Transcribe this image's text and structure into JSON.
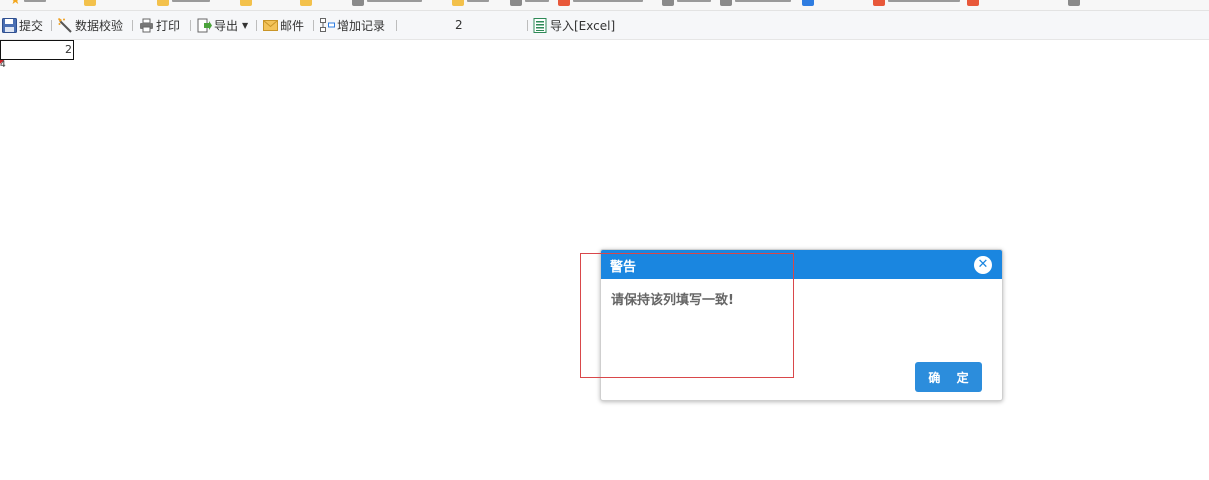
{
  "toolbar": {
    "submit_label": "提交",
    "validate_label": "数据校验",
    "print_label": "打印",
    "export_label": "导出",
    "mail_label": "邮件",
    "add_record_label": "增加记录",
    "page_number": "2",
    "import_excel_label": "导入[Excel]"
  },
  "sheet": {
    "cell_value": "2",
    "row_marker": "4"
  },
  "dialog": {
    "title": "警告",
    "message": "请保持该列填写一致!",
    "ok_label": "确 定"
  },
  "colors": {
    "dialog_header": "#1a86e0",
    "ok_button": "#2c8ddc",
    "highlight_border": "#d9474a"
  }
}
